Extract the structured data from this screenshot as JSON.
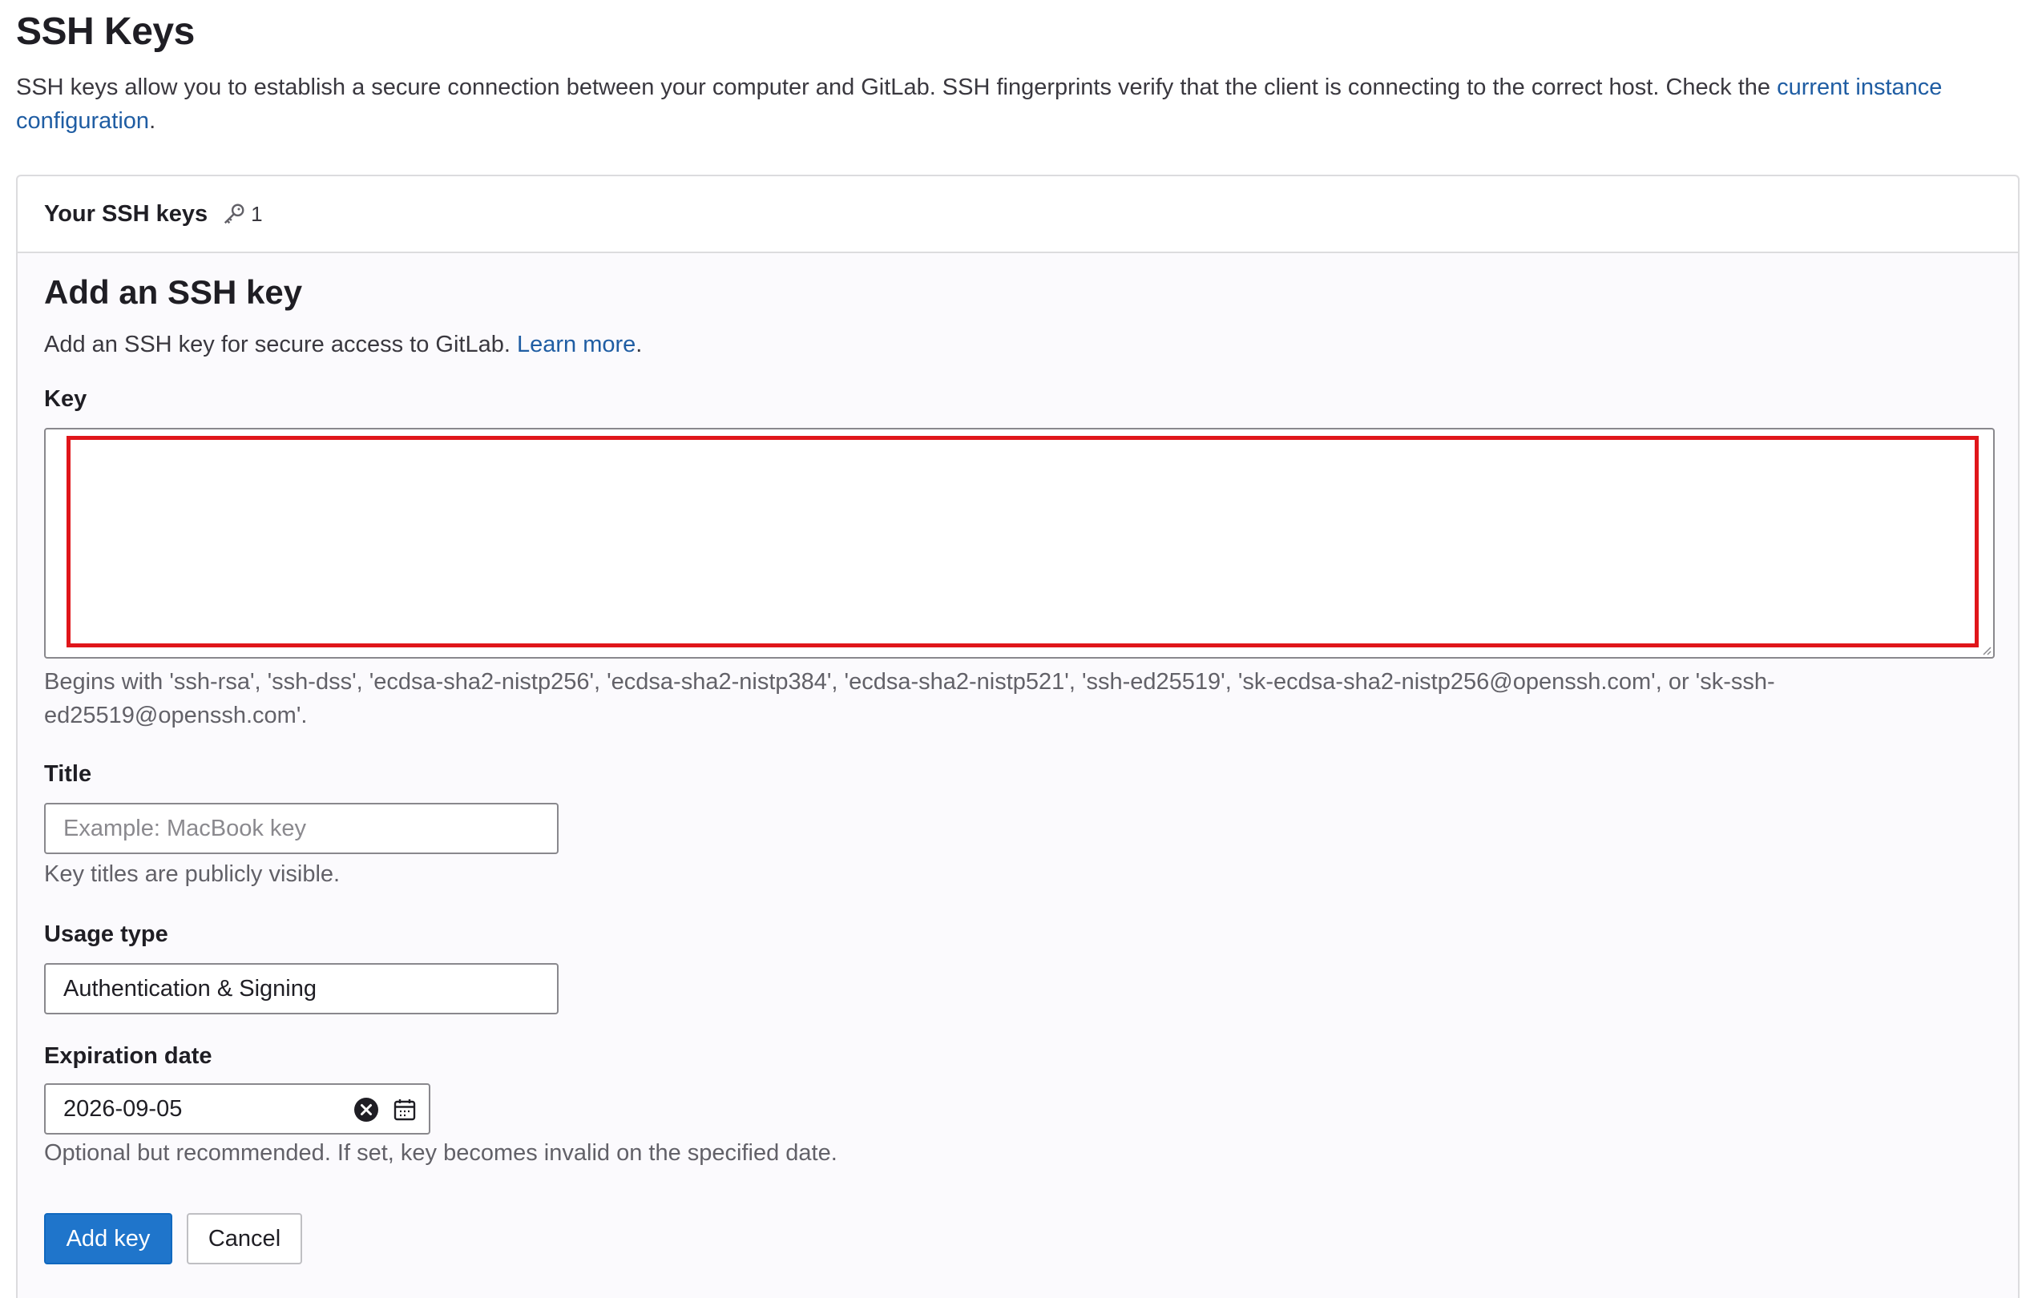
{
  "page": {
    "title": "SSH Keys",
    "intro_text": "SSH keys allow you to establish a secure connection between your computer and GitLab. SSH fingerprints verify that the client is connecting to the correct host. Check the ",
    "intro_link": "current instance configuration",
    "intro_end": "."
  },
  "card": {
    "header_title": "Your SSH keys",
    "header_icon": "key-icon",
    "key_count": "1"
  },
  "form": {
    "title": "Add an SSH key",
    "description": "Add an SSH key for secure access to GitLab. ",
    "description_link": "Learn more",
    "description_end": ".",
    "key_label": "Key",
    "key_value": "",
    "key_help": "Begins with 'ssh-rsa', 'ssh-dss', 'ecdsa-sha2-nistp256', 'ecdsa-sha2-nistp384', 'ecdsa-sha2-nistp521', 'ssh-ed25519', 'sk-ecdsa-sha2-nistp256@openssh.com', or 'sk-ssh-ed25519@openssh.com'.",
    "title_label": "Title",
    "title_placeholder": "Example: MacBook key",
    "title_value": "",
    "title_help": "Key titles are publicly visible.",
    "usage_label": "Usage type",
    "usage_value": "Authentication & Signing",
    "expiration_label": "Expiration date",
    "expiration_value": "2026-09-05",
    "expiration_help": "Optional but recommended. If set, key becomes invalid on the specified date.",
    "add_button": "Add key",
    "cancel_button": "Cancel"
  },
  "colors": {
    "link": "#1f5da3",
    "primary_button": "#1f75cb",
    "highlight_outline": "#e0161a",
    "border": "#89888d"
  }
}
